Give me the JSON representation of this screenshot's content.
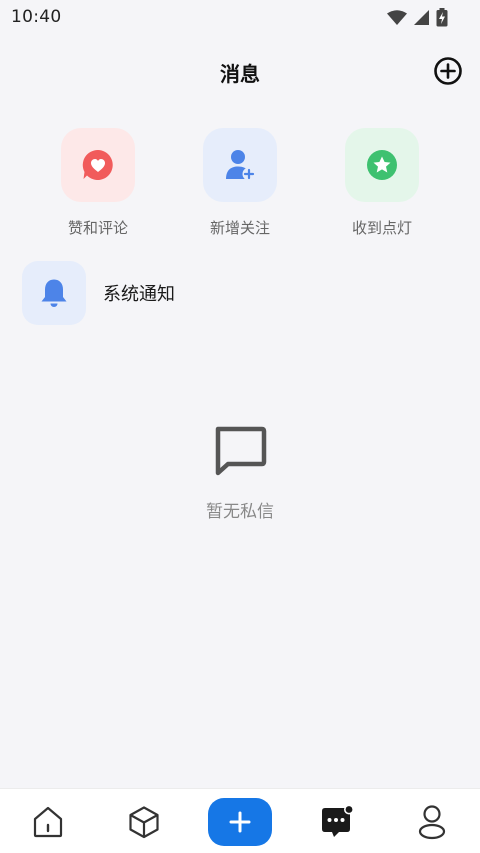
{
  "status_bar": {
    "time": "10:40",
    "icons": [
      "wifi-icon",
      "cellular-signal-icon",
      "battery-charging-icon"
    ]
  },
  "header": {
    "title": "消息",
    "add_icon": "add-circle-icon"
  },
  "quick_actions": [
    {
      "label": "赞和评论",
      "icon": "heart-bubble-icon",
      "color": "#f15b5b",
      "bg": "#fde8e8"
    },
    {
      "label": "新增关注",
      "icon": "add-user-icon",
      "color": "#4d84e8",
      "bg": "#e6edfb"
    },
    {
      "label": "收到点灯",
      "icon": "star-badge-icon",
      "color": "#3ec170",
      "bg": "#e4f6ea"
    }
  ],
  "system_notice": {
    "label": "系统通知",
    "icon": "bell-icon",
    "color": "#4d84e8"
  },
  "empty_state": {
    "icon": "chat-bubble-icon",
    "text": "暂无私信"
  },
  "bottom_nav": {
    "items": [
      {
        "name": "home",
        "icon": "home-icon"
      },
      {
        "name": "explore",
        "icon": "cube-icon"
      },
      {
        "name": "publish",
        "icon": "plus-icon"
      },
      {
        "name": "messages",
        "icon": "message-icon",
        "active": true,
        "has_dot": true
      },
      {
        "name": "profile",
        "icon": "user-icon"
      }
    ],
    "accent": "#1677e6"
  }
}
